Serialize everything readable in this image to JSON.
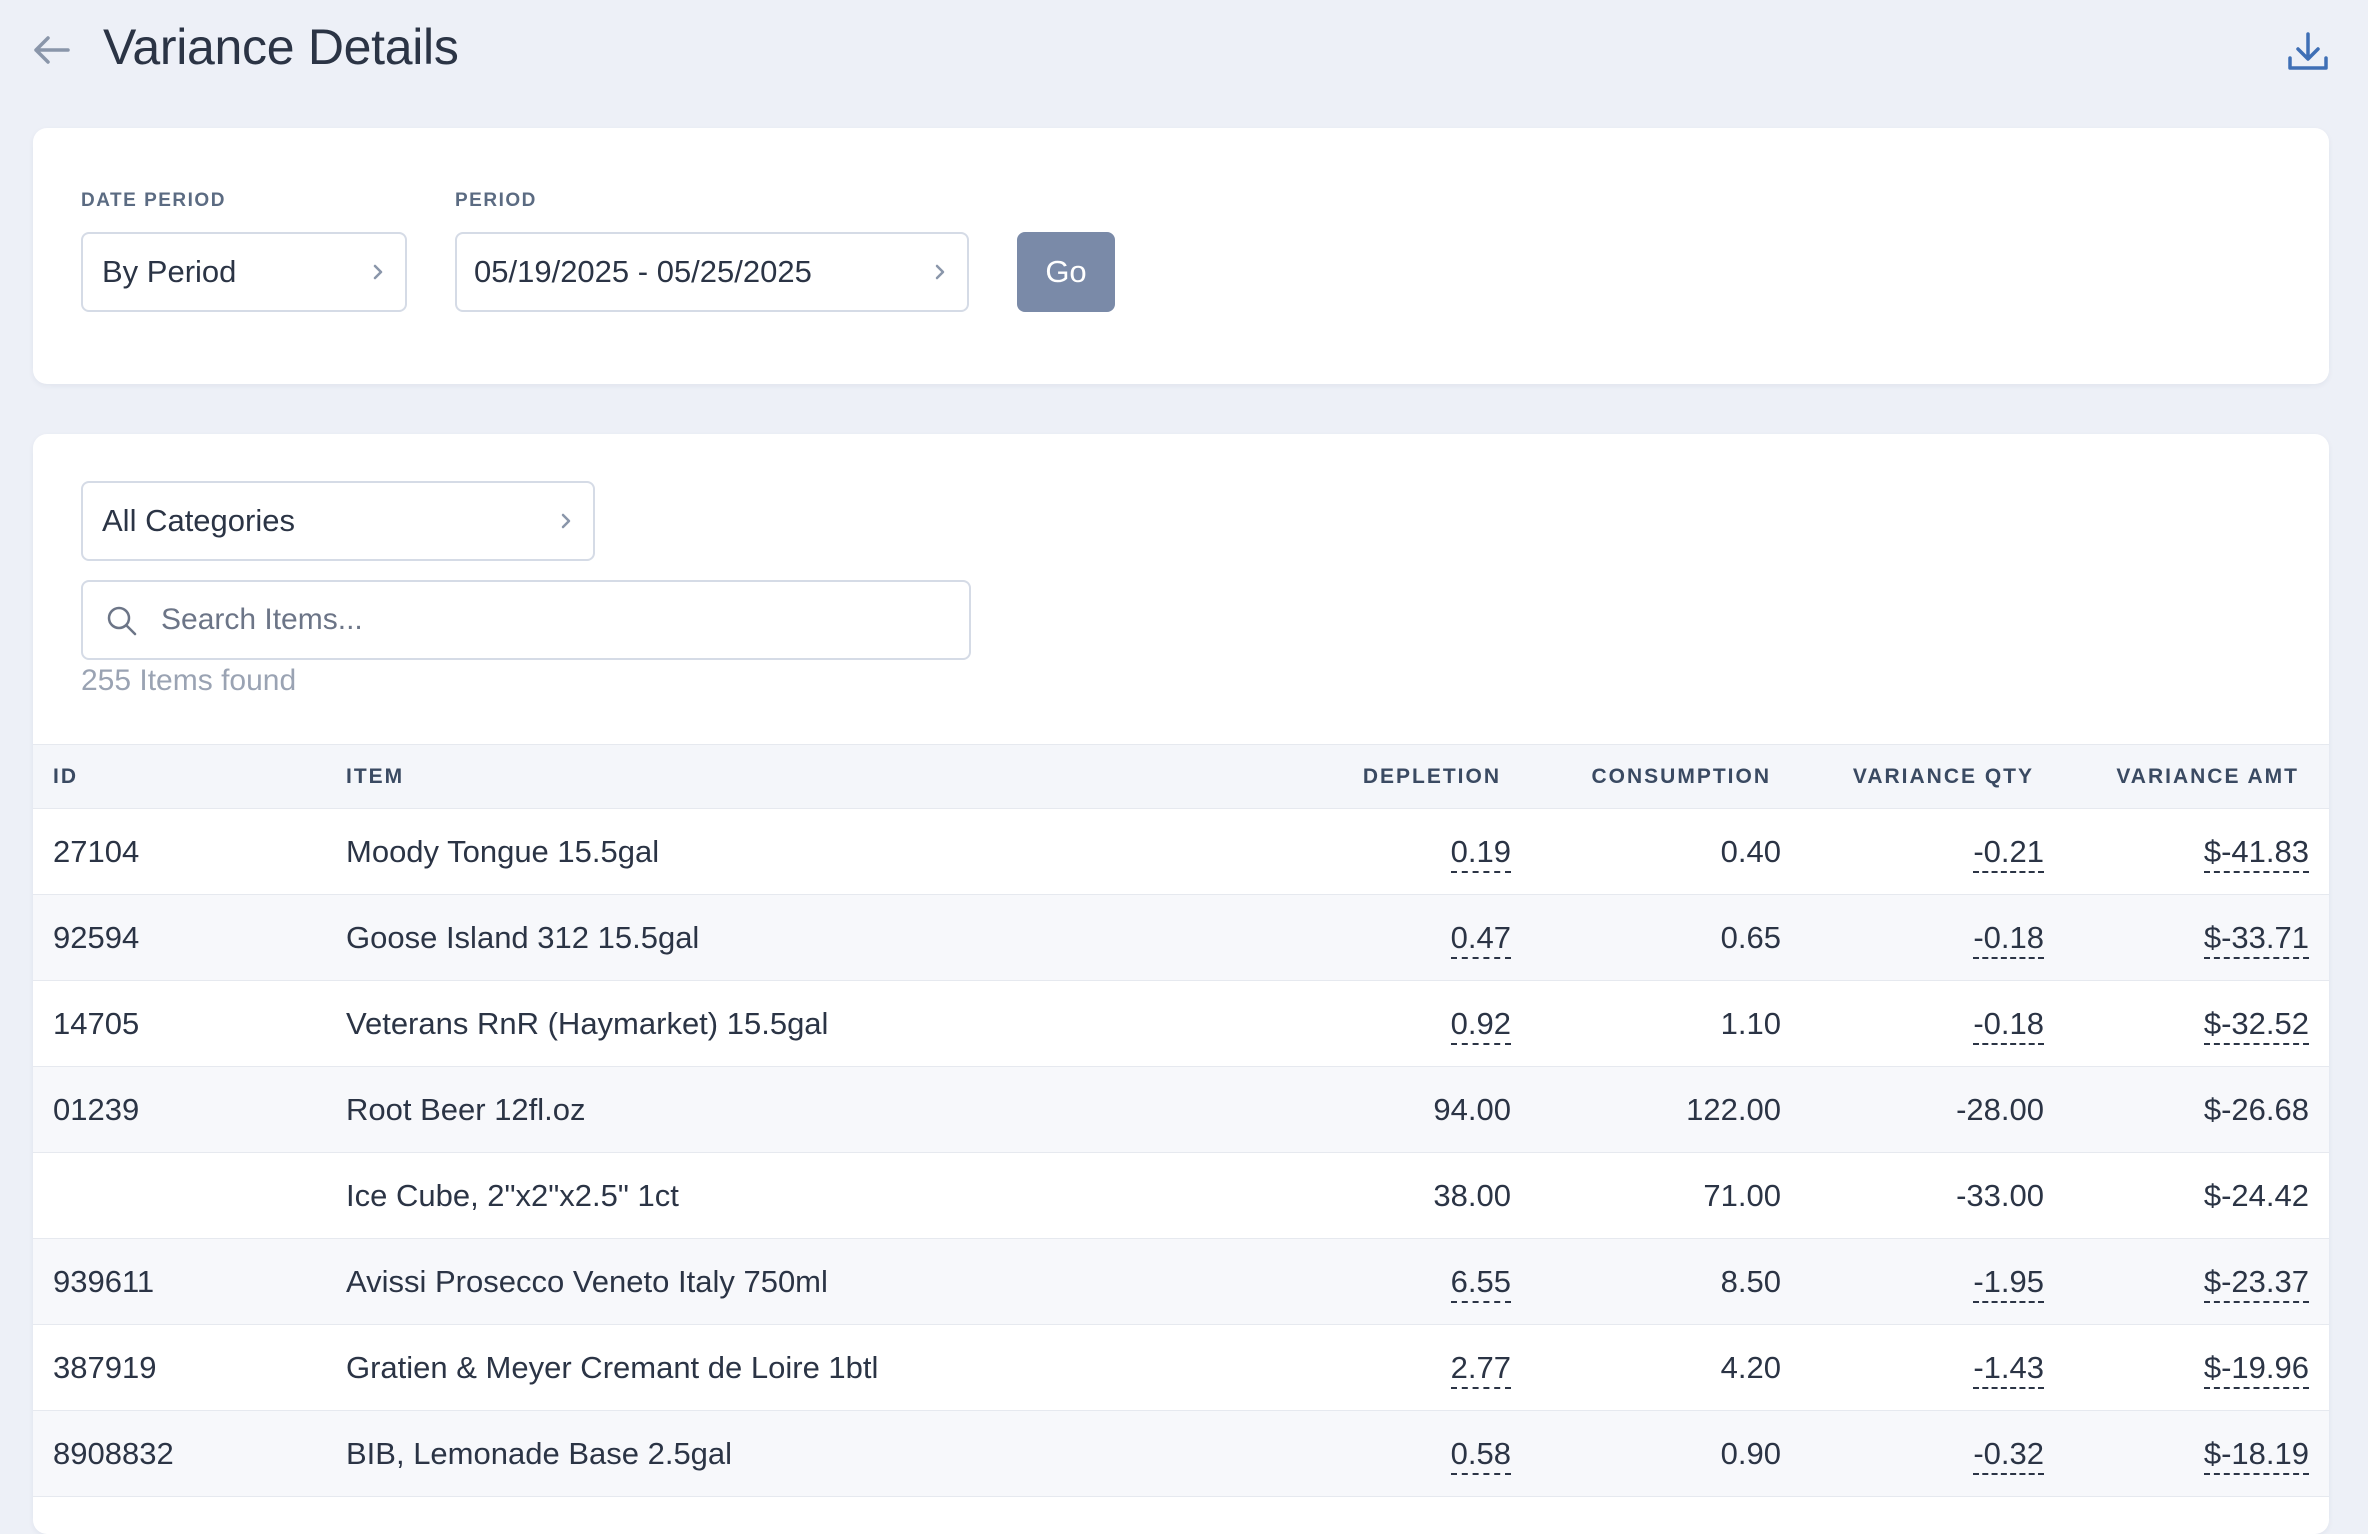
{
  "header": {
    "title": "Variance Details",
    "back_icon": "arrow-left-icon",
    "download_icon": "download-icon"
  },
  "filters": {
    "date_period_label": "DATE PERIOD",
    "date_period_value": "By Period",
    "period_label": "PERIOD",
    "period_value": "05/19/2025 - 05/25/2025",
    "go_label": "Go"
  },
  "list": {
    "category_value": "All Categories",
    "search_placeholder": "Search Items...",
    "count_text": "255 Items found",
    "columns": {
      "id": "ID",
      "item": "ITEM",
      "depletion": "DEPLETION",
      "consumption": "CONSUMPTION",
      "variance_qty": "VARIANCE QTY",
      "variance_amt": "VARIANCE AMT"
    },
    "rows": [
      {
        "id": "27104",
        "item": "Moody Tongue 15.5gal",
        "depletion": "0.19",
        "consumption": "0.40",
        "variance_qty": "-0.21",
        "variance_amt": "$-41.83",
        "linked": true
      },
      {
        "id": "92594",
        "item": "Goose Island 312 15.5gal",
        "depletion": "0.47",
        "consumption": "0.65",
        "variance_qty": "-0.18",
        "variance_amt": "$-33.71",
        "linked": true
      },
      {
        "id": "14705",
        "item": "Veterans RnR (Haymarket) 15.5gal",
        "depletion": "0.92",
        "consumption": "1.10",
        "variance_qty": "-0.18",
        "variance_amt": "$-32.52",
        "linked": true
      },
      {
        "id": "01239",
        "item": "Root Beer 12fl.oz",
        "depletion": "94.00",
        "consumption": "122.00",
        "variance_qty": "-28.00",
        "variance_amt": "$-26.68",
        "linked": false
      },
      {
        "id": "",
        "item": "Ice Cube, 2\"x2\"x2.5\" 1ct",
        "depletion": "38.00",
        "consumption": "71.00",
        "variance_qty": "-33.00",
        "variance_amt": "$-24.42",
        "linked": false
      },
      {
        "id": "939611",
        "item": "Avissi Prosecco Veneto Italy 750ml",
        "depletion": "6.55",
        "consumption": "8.50",
        "variance_qty": "-1.95",
        "variance_amt": "$-23.37",
        "linked": true
      },
      {
        "id": "387919",
        "item": "Gratien & Meyer Cremant de Loire 1btl",
        "depletion": "2.77",
        "consumption": "4.20",
        "variance_qty": "-1.43",
        "variance_amt": "$-19.96",
        "linked": true
      },
      {
        "id": "8908832",
        "item": "BIB, Lemonade Base 2.5gal",
        "depletion": "0.58",
        "consumption": "0.90",
        "variance_qty": "-0.32",
        "variance_amt": "$-18.19",
        "linked": true
      }
    ]
  }
}
